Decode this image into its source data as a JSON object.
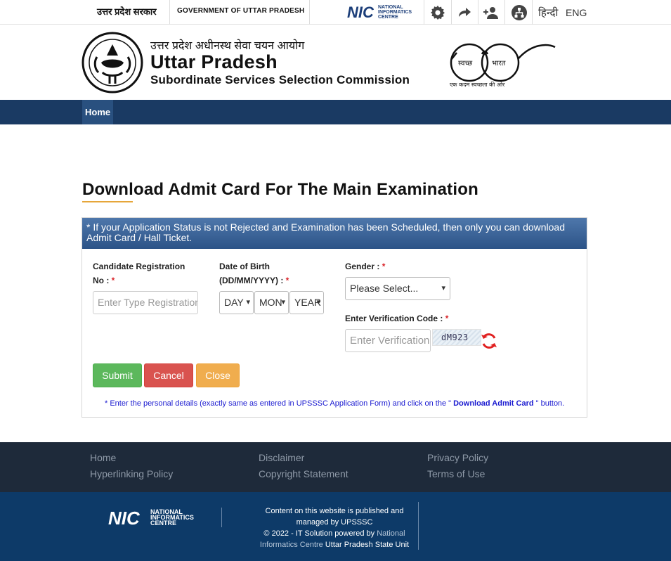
{
  "topbar": {
    "gov_hindi": "उत्तर प्रदेश सरकार",
    "gov_english": "GOVERNMENT OF UTTAR PRADESH",
    "nic_logo_text": "NIC",
    "nic_logo_sub": [
      "NATIONAL",
      "INFORMATICS",
      "CENTRE"
    ],
    "icons": [
      "gear-icon",
      "share-icon",
      "add-user-icon",
      "sitemap-icon"
    ],
    "lang_hindi": "हिन्दी",
    "lang_english": "ENG"
  },
  "header": {
    "hindi_title": "उत्तर प्रदेश अधीनस्थ सेवा चयन आयोग",
    "title": "Uttar Pradesh",
    "subtitle": "Subordinate Services Selection Commission",
    "swachh_left": "स्वच्छ",
    "swachh_right": "भारत",
    "swachh_tagline": "एक कदम स्वच्छता की ओर"
  },
  "nav": {
    "home": "Home"
  },
  "main": {
    "title": "Download Admit Card For The Main Examination",
    "notice": "* If your Application Status is not Rejected and Examination has been Scheduled, then only you can download Admit Card / Hall Ticket.",
    "reg_label_1": "Candidate Registration",
    "reg_label_2": "No : ",
    "reg_placeholder": "Enter Type Registration",
    "dob_label_1": "Date of Birth",
    "dob_label_2": "(DD/MM/YYYY) : ",
    "day": "DAY",
    "month": "MON",
    "year": "YEAR",
    "gender_label": "Gender : ",
    "gender_value": "Please Select...",
    "verify_label": "Enter Verification Code : ",
    "verify_placeholder": "Enter Verification",
    "captcha_text": "dM923",
    "required_mark": "*",
    "submit": "Submit",
    "cancel": "Cancel",
    "close": "Close",
    "note_before": "* Enter the personal details (exactly same as entered in UPSSSC Application Form) and click on the \" ",
    "note_bold": "Download Admit Card",
    "note_after": " \" button."
  },
  "footer": {
    "links": [
      "Home",
      "Hyperlinking Policy",
      "Disclaimer",
      "Copyright Statement",
      "Privacy Policy",
      "Terms of Use"
    ],
    "copy_1": "Content on this website is published and",
    "copy_2": "managed by UPSSSC",
    "copy_3a": "© 2022 - IT Solution powered by ",
    "copy_3b": "National",
    "copy_4a": "Informatics Centre ",
    "copy_4b": "Uttar Pradesh State Unit"
  },
  "colors": {
    "navbar": "#1a3a63",
    "submit": "#5cb85c",
    "cancel": "#d9534f",
    "close": "#f0ad4e",
    "footer_top": "#1e2a3a",
    "footer_bottom": "#0d3a68"
  }
}
